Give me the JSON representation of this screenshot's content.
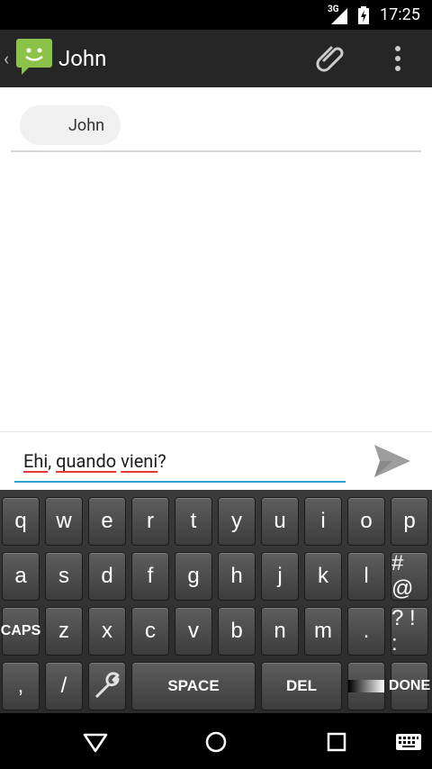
{
  "status": {
    "network": "3G",
    "time": "17:25"
  },
  "actionbar": {
    "title": "John",
    "back": "‹",
    "app_color": "#8bc34a"
  },
  "recipient": {
    "name": "John"
  },
  "compose": {
    "words": [
      "Ehi",
      ", ",
      "quando",
      " ",
      "vieni",
      "?"
    ]
  },
  "keyboard": {
    "row1": [
      "q",
      "w",
      "e",
      "r",
      "t",
      "y",
      "u",
      "i",
      "o",
      "p"
    ],
    "row2": [
      "a",
      "s",
      "d",
      "f",
      "g",
      "h",
      "j",
      "k",
      "l",
      "# @"
    ],
    "row3": [
      "CAPS",
      "z",
      "x",
      "c",
      "v",
      "b",
      "n",
      "m",
      ".",
      "? ! :"
    ],
    "row4": {
      "comma": ",",
      "slash": "/",
      "space": "SPACE",
      "del": "DEL",
      "done": "DONE"
    }
  }
}
